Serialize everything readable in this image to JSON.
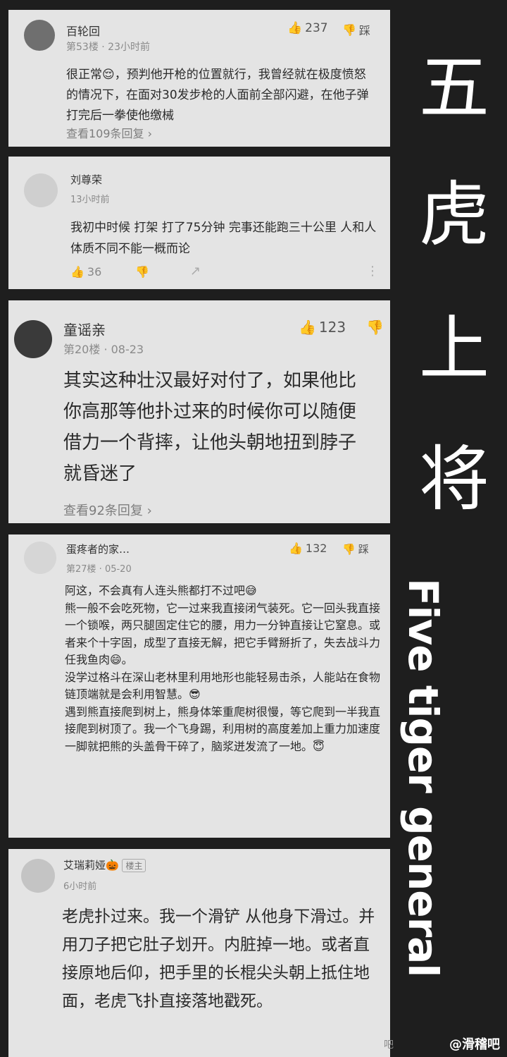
{
  "side_title_chars": [
    "五",
    "虎",
    "上",
    "将"
  ],
  "side_title_en": "Five tiger general",
  "watermark": "@滑稽吧",
  "watermark_left": "吧",
  "comments": [
    {
      "user": "百轮回",
      "meta": "第53楼 · 23小时前",
      "likes": "237",
      "dislike_label": "踩",
      "text": "很正常😌，预判他开枪的位置就行，我曾经就在极度愤怒的情况下，在面对30发步枪的人面前全部闪避，在他子弹打完后一拳使他缴械",
      "more": "查看109条回复 ›"
    },
    {
      "user": "刘尊荣",
      "meta": "13小时前",
      "text": "我初中时候 打架 打了75分钟 完事还能跑三十公里 人和人体质不同不能一概而论",
      "likes": "36"
    },
    {
      "user": "童谣亲",
      "meta": "第20楼 · 08-23",
      "likes": "123",
      "text": "其实这种壮汉最好对付了，如果他比你高那等他扑过来的时候你可以随便借力一个背摔，让他头朝地扭到脖子就昏迷了",
      "more": "查看92条回复 ›"
    },
    {
      "user": "蛋疼者的家…",
      "meta": "第27楼 · 05-20",
      "likes": "132",
      "dislike_label": "踩",
      "text": "阿这，不会真有人连头熊都打不过吧😅\n熊一般不会吃死物，它一过来我直接闭气装死。它一回头我直接一个锁喉，两只腿固定住它的腰，用力一分钟直接让它窒息。或者来个十字固，成型了直接无解，把它手臂掰折了，失去战斗力任我鱼肉😄。\n没学过格斗在深山老林里利用地形也能轻易击杀，人能站在食物链顶端就是会利用智慧。😎\n遇到熊直接爬到树上，熊身体笨重爬树很慢，等它爬到一半我直接爬到树顶了。我一个飞身踢，利用树的高度差加上重力加速度一脚就把熊的头盖骨干碎了，脑浆迸发流了一地。😇"
    },
    {
      "user": "艾瑞莉娅🎃",
      "badge": "楼主",
      "meta": "6小时前",
      "text": "老虎扑过来。我一个滑铲 从他身下滑过。并用刀子把它肚子划开。内脏掉一地。或者直接原地后仰，把手里的长棍尖头朝上抵住地面，老虎飞扑直接落地戳死。"
    }
  ]
}
